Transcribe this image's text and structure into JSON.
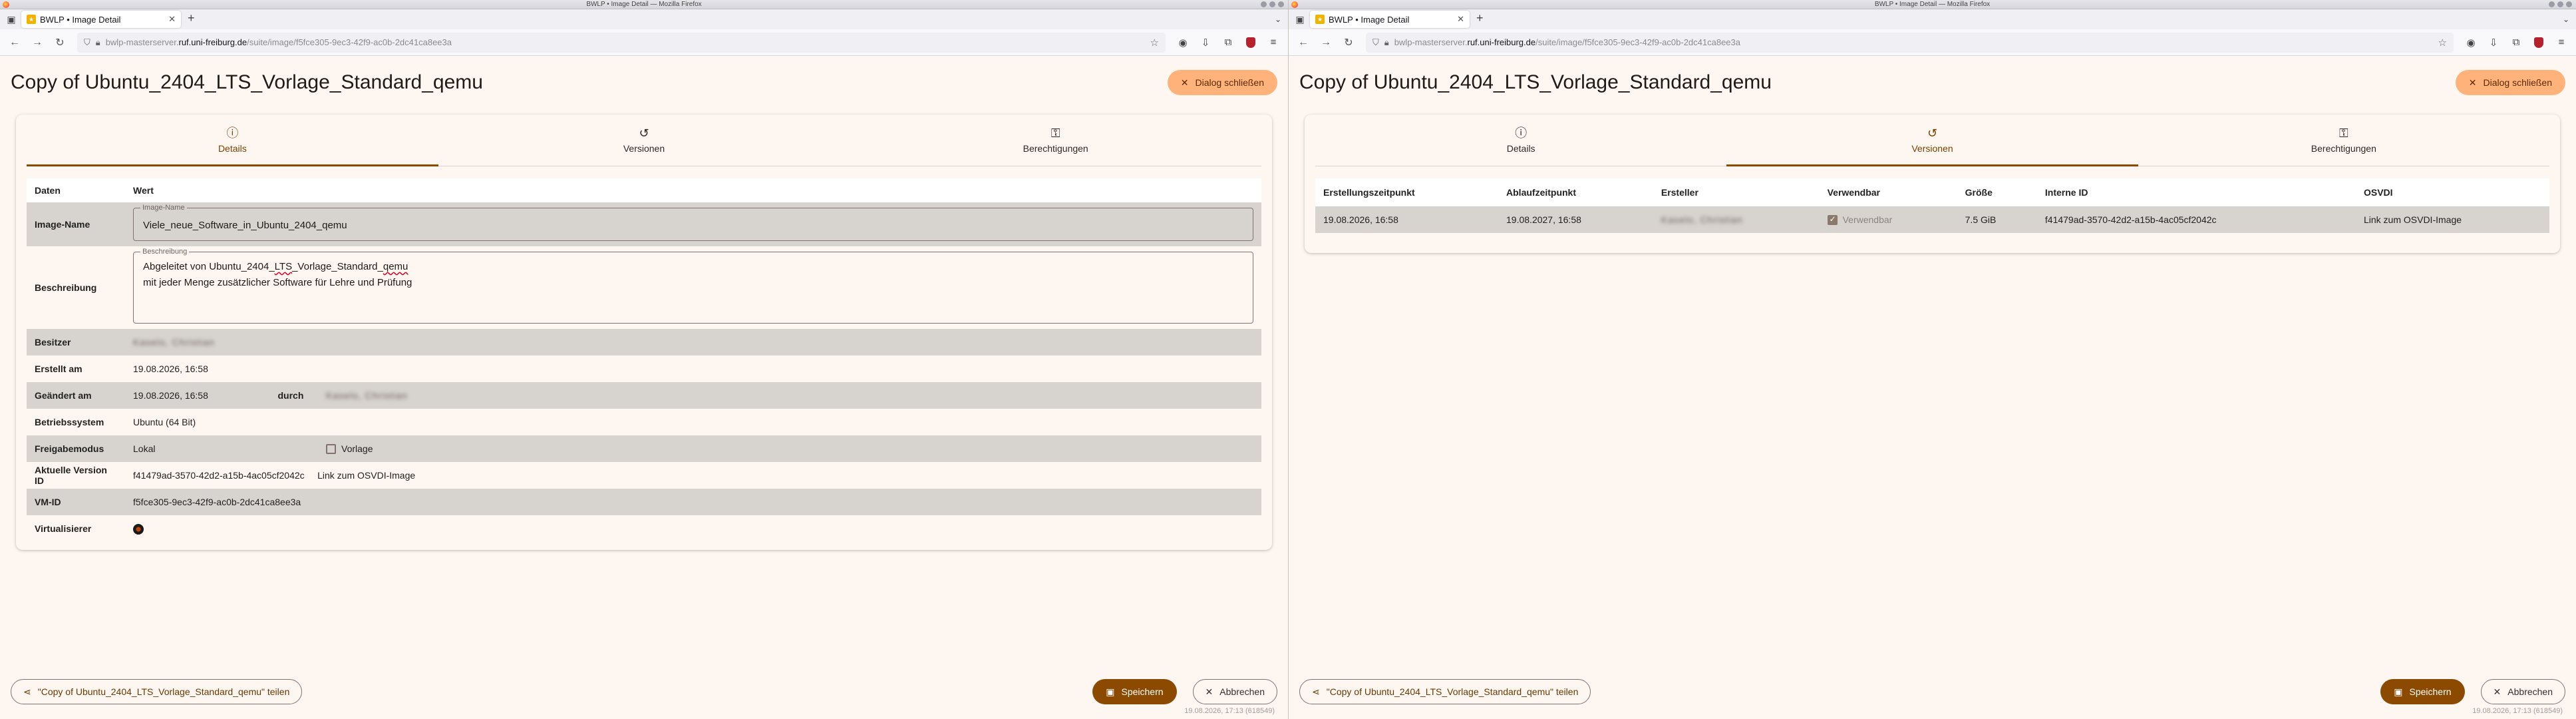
{
  "browser": {
    "window_title": "BWLP • Image Detail — Mozilla Firefox",
    "tab_title": "BWLP • Image Detail",
    "url_prefix": "bwlp-masterserver.",
    "url_domain": "ruf.uni-freiburg.de",
    "url_path": "/suite/image/f5fce305-9ec3-42f9-ac0b-2dc41ca8ee3a"
  },
  "page": {
    "title": "Copy of Ubuntu_2404_LTS_Vorlage_Standard_qemu",
    "close_dialog": "Dialog schließen"
  },
  "tabs": {
    "details": "Details",
    "versions": "Versionen",
    "permissions": "Berechtigungen"
  },
  "details": {
    "header_key": "Daten",
    "header_value": "Wert",
    "image_name_label": "Image-Name",
    "image_name_field_label": "Image-Name",
    "image_name_value": "Viele_neue_Software_in_Ubuntu_2404_qemu",
    "description_label": "Beschreibung",
    "description_field_label": "Beschreibung",
    "description_line1_pre": "Abgeleitet von Ubuntu_2404_",
    "description_line1_lts": "LTS",
    "description_line1_mid": "_Vorlage_Standard_",
    "description_line1_qemu": "qemu",
    "description_line2": "mit jeder Menge zusätzlicher Software für Lehre und Prüfung",
    "owner_label": "Besitzer",
    "owner_value": "Kaselo, Christian",
    "created_label": "Erstellt am",
    "created_value": "19.08.2026, 16:58",
    "changed_label": "Geändert am",
    "changed_value": "19.08.2026, 16:58",
    "changed_by_label": "durch",
    "changed_by_value": "Kaselo, Christian",
    "os_label": "Betriebssystem",
    "os_value": "Ubuntu (64 Bit)",
    "share_label": "Freigabemodus",
    "share_value": "Lokal",
    "template_label": "Vorlage",
    "current_version_label": "Aktuelle Version ID",
    "current_version_value": "f41479ad-3570-42d2-a15b-4ac05cf2042c",
    "osvdi_link": "Link zum OSVDI-Image",
    "vm_id_label": "VM-ID",
    "vm_id_value": "f5fce305-9ec3-42f9-ac0b-2dc41ca8ee3a",
    "virtualizer_label": "Virtualisierer"
  },
  "versions": {
    "headers": [
      "Erstellungszeitpunkt",
      "Ablaufzeitpunkt",
      "Ersteller",
      "Verwendbar",
      "Größe",
      "Interne ID",
      "OSVDI"
    ],
    "row": {
      "created": "19.08.2026, 16:58",
      "expires": "19.08.2027, 16:58",
      "creator": "Kaselo, Christian",
      "usable": "Verwendbar",
      "size": "7.5 GiB",
      "internal_id": "f41479ad-3570-42d2-a15b-4ac05cf2042c",
      "osvdi": "Link zum OSVDI-Image"
    }
  },
  "footer": {
    "share_button": "\"Copy of Ubuntu_2404_LTS_Vorlage_Standard_qemu\" teilen",
    "save_button": "Speichern",
    "cancel_button": "Abbrechen",
    "timestamp": "19.08.2026, 17:13 (618549)"
  },
  "colors": {
    "primary": "#8b4a00",
    "accent": "#ffb37b",
    "background": "#fdf6f1",
    "row_alt": "#d7d3cf"
  }
}
